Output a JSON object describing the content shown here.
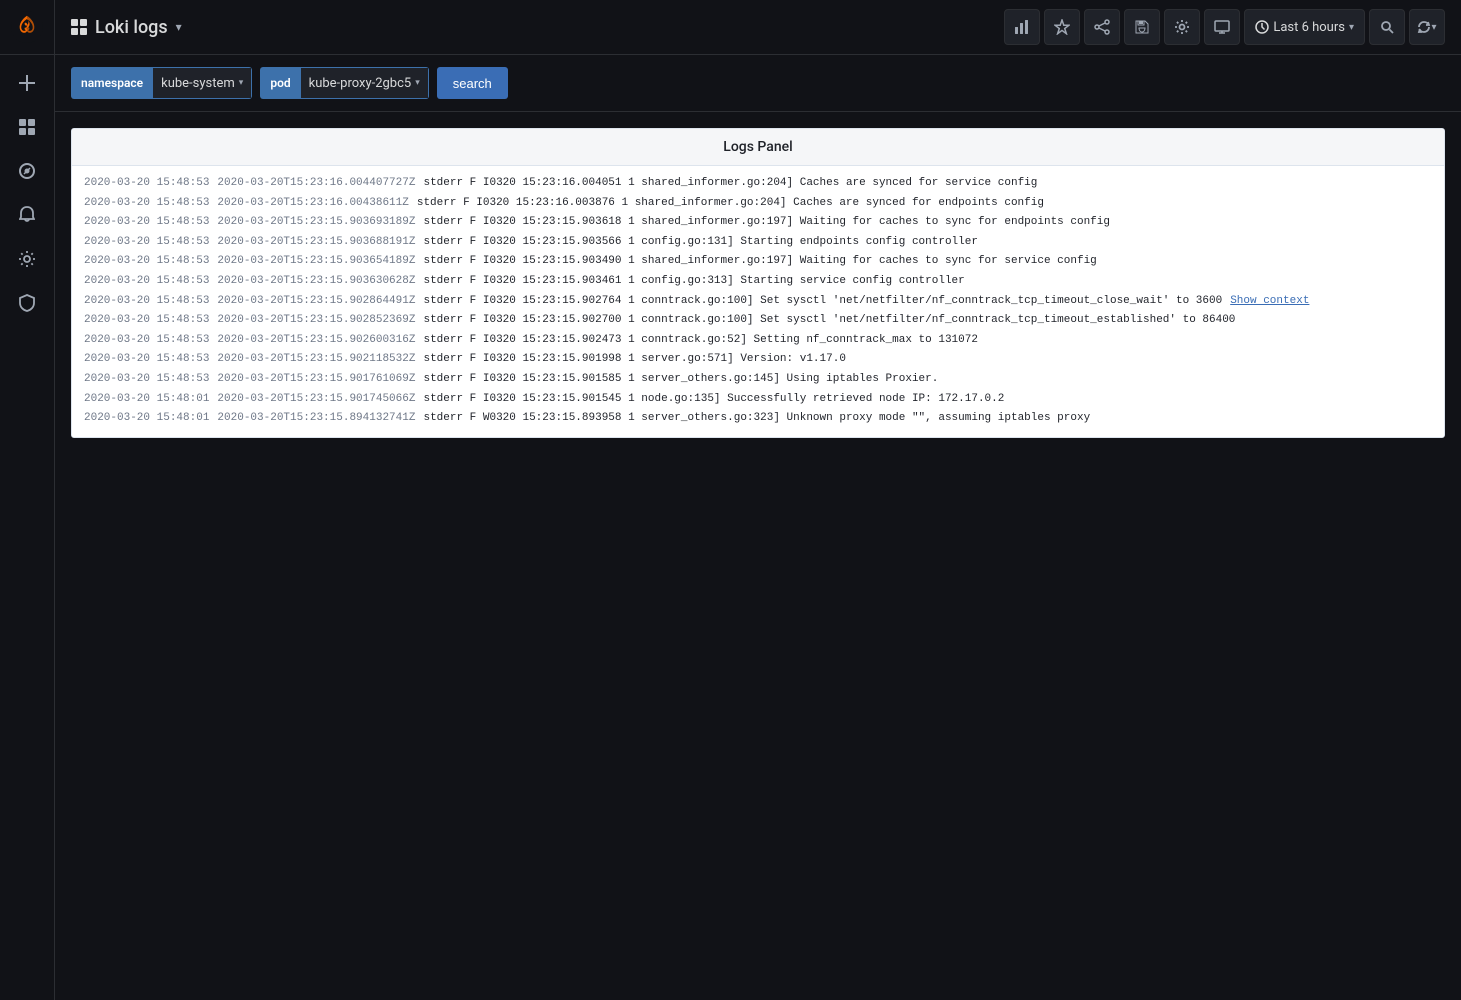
{
  "sidebar": {
    "logo_alt": "Grafana",
    "items": [
      {
        "id": "add",
        "icon": "plus-icon",
        "label": "Add"
      },
      {
        "id": "dashboard",
        "icon": "dashboard-icon",
        "label": "Dashboards"
      },
      {
        "id": "explore",
        "icon": "explore-icon",
        "label": "Explore"
      },
      {
        "id": "alerting",
        "icon": "bell-icon",
        "label": "Alerting"
      },
      {
        "id": "configuration",
        "icon": "gear-icon",
        "label": "Configuration"
      },
      {
        "id": "shield",
        "icon": "shield-icon",
        "label": "Server Admin"
      }
    ]
  },
  "topbar": {
    "grid_icon": "apps-grid-icon",
    "title": "Loki logs",
    "title_caret": "▾",
    "actions": [
      {
        "id": "chart",
        "icon": "bar-chart-icon",
        "label": "Visualize"
      },
      {
        "id": "star",
        "icon": "star-icon",
        "label": "Star dashboard"
      },
      {
        "id": "share",
        "icon": "share-icon",
        "label": "Share dashboard"
      },
      {
        "id": "save",
        "icon": "save-icon",
        "label": "Save dashboard"
      },
      {
        "id": "settings",
        "icon": "settings-icon",
        "label": "Dashboard settings"
      },
      {
        "id": "tv",
        "icon": "tv-icon",
        "label": "Cycle view mode"
      }
    ],
    "time_picker": {
      "label": "Last 6 hours",
      "icon": "clock-icon"
    },
    "search_icon": "search-icon",
    "refresh_icon": "refresh-icon"
  },
  "query_bar": {
    "filters": [
      {
        "key": "namespace",
        "value": "kube-system"
      },
      {
        "key": "pod",
        "value": "kube-proxy-2gbc5"
      }
    ],
    "search_button": "search"
  },
  "logs_panel": {
    "title": "Logs Panel",
    "rows": [
      {
        "ts1": "2020-03-20 15:48:53",
        "ts2": "2020-03-20T15:23:16.004407727Z",
        "text": "stderr F I0320 15:23:16.004051 1 shared_informer.go:204] Caches are synced for service config"
      },
      {
        "ts1": "2020-03-20 15:48:53",
        "ts2": "2020-03-20T15:23:16.00438611Z",
        "text": "stderr F I0320 15:23:16.003876 1 shared_informer.go:204] Caches are synced for endpoints config"
      },
      {
        "ts1": "2020-03-20 15:48:53",
        "ts2": "2020-03-20T15:23:15.903693189Z",
        "text": "stderr F I0320 15:23:15.903618 1 shared_informer.go:197] Waiting for caches to sync for endpoints config"
      },
      {
        "ts1": "2020-03-20 15:48:53",
        "ts2": "2020-03-20T15:23:15.903688191Z",
        "text": "stderr F I0320 15:23:15.903566 1 config.go:131] Starting endpoints config controller"
      },
      {
        "ts1": "2020-03-20 15:48:53",
        "ts2": "2020-03-20T15:23:15.903654189Z",
        "text": "stderr F I0320 15:23:15.903490 1 shared_informer.go:197] Waiting for caches to sync for service config"
      },
      {
        "ts1": "2020-03-20 15:48:53",
        "ts2": "2020-03-20T15:23:15.903630628Z",
        "text": "stderr F I0320 15:23:15.903461 1 config.go:313] Starting service config controller"
      },
      {
        "ts1": "2020-03-20 15:48:53",
        "ts2": "2020-03-20T15:23:15.902864491Z",
        "text": "stderr F I0320 15:23:15.902764 1 conntrack.go:100] Set sysctl 'net/netfilter/nf_conntrack_tcp_timeout_close_wait' to 3600",
        "show_context": true
      },
      {
        "ts1": "2020-03-20 15:48:53",
        "ts2": "2020-03-20T15:23:15.902852369Z",
        "text": "stderr F I0320 15:23:15.902700 1 conntrack.go:100] Set sysctl 'net/netfilter/nf_conntrack_tcp_timeout_established' to 86400"
      },
      {
        "ts1": "2020-03-20 15:48:53",
        "ts2": "2020-03-20T15:23:15.902600316Z",
        "text": "stderr F I0320 15:23:15.902473 1 conntrack.go:52] Setting nf_conntrack_max to 131072"
      },
      {
        "ts1": "2020-03-20 15:48:53",
        "ts2": "2020-03-20T15:23:15.902118532Z",
        "text": "stderr F I0320 15:23:15.901998 1 server.go:571] Version: v1.17.0"
      },
      {
        "ts1": "2020-03-20 15:48:53",
        "ts2": "2020-03-20T15:23:15.901761069Z",
        "text": "stderr F I0320 15:23:15.901585 1 server_others.go:145] Using iptables Proxier."
      },
      {
        "ts1": "2020-03-20 15:48:01",
        "ts2": "2020-03-20T15:23:15.901745066Z",
        "text": "stderr F I0320 15:23:15.901545 1 node.go:135] Successfully retrieved node IP: 172.17.0.2"
      },
      {
        "ts1": "2020-03-20 15:48:01",
        "ts2": "2020-03-20T15:23:15.894132741Z",
        "text": "stderr F W0320 15:23:15.893958 1 server_others.go:323] Unknown proxy mode \"\", assuming iptables proxy"
      }
    ]
  }
}
